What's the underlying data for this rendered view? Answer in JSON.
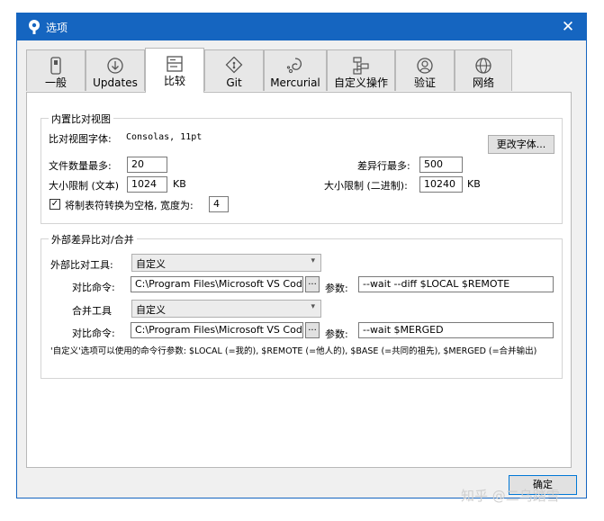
{
  "window": {
    "title": "选项",
    "close_symbol": "✕"
  },
  "tabs": [
    {
      "label": "一般",
      "icon": "general-icon"
    },
    {
      "label": "Updates",
      "icon": "updates-icon"
    },
    {
      "label": "比较",
      "icon": "compare-icon"
    },
    {
      "label": "Git",
      "icon": "git-icon"
    },
    {
      "label": "Mercurial",
      "icon": "mercurial-icon"
    },
    {
      "label": "自定义操作",
      "icon": "custom-actions-icon"
    },
    {
      "label": "验证",
      "icon": "authentication-icon"
    },
    {
      "label": "网络",
      "icon": "network-icon"
    }
  ],
  "active_tab": "比较",
  "builtin": {
    "title": "内置比对视图",
    "font_label": "比对视图字体:",
    "font_value": "Consolas, 11pt",
    "change_font_button": "更改字体...",
    "max_files_label": "文件数量最多:",
    "max_files_value": "20",
    "max_diff_lines_label": "差异行最多:",
    "max_diff_lines_value": "500",
    "text_size_label": "大小限制 (文本)",
    "text_size_value": "1024",
    "text_size_unit": "KB",
    "binary_size_label": "大小限制 (二进制):",
    "binary_size_value": "10240",
    "binary_size_unit": "KB",
    "tabs_to_spaces_label": "将制表符转换为空格, 宽度为:",
    "tabs_to_spaces_checked": true,
    "tab_width_value": "4",
    "checkmark": "✓"
  },
  "external": {
    "title": "外部差异比对/合并",
    "diff_tool_label": "外部比对工具:",
    "diff_tool_value": "自定义",
    "diff_command_label": "对比命令:",
    "diff_command_value": "C:\\Program Files\\Microsoft VS Code",
    "diff_args_label": "参数:",
    "diff_args_value": "--wait --diff $LOCAL $REMOTE",
    "merge_tool_label": "合并工具",
    "merge_tool_value": "自定义",
    "merge_command_label": "对比命令:",
    "merge_command_value": "C:\\Program Files\\Microsoft VS Code",
    "merge_args_label": "参数:",
    "merge_args_value": "--wait $MERGED",
    "browse_label": "...",
    "dropdown_arrow": "▾",
    "note": "'自定义'选项可以使用的命令行参数: $LOCAL (=我的), $REMOTE (=他人的), $BASE (=共同的祖先), $MERGED (=合并输出)"
  },
  "ok_button": "确定",
  "watermark": "知乎 @二乌踏雪",
  "colors": {
    "titlebar": "#1565c0",
    "window_bg": "#f0f0f0",
    "panel_bg": "#ffffff"
  }
}
